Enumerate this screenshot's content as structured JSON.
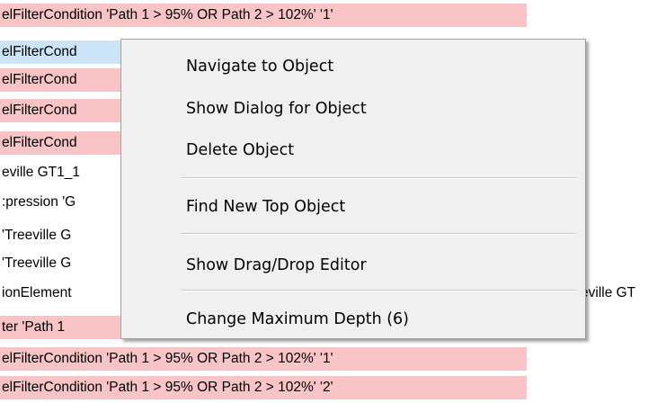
{
  "tree": {
    "rows": [
      "elFilterCondition 'Path 1 > 95% OR Path 2 > 102%' '1'",
      "elFilterCond",
      "elFilterCond",
      "elFilterCond",
      "elFilterCond",
      "eville GT1_1",
      ":pression 'G",
      " 'Treeville G",
      " 'Treeville G",
      "ionElement",
      "ter 'Path 1",
      "elFilterCondition 'Path 1 > 95% OR Path 2 > 102%' '1'",
      "elFilterCondition 'Path 1 > 95% OR Path 2 > 102%' '2'"
    ],
    "row_suffix_right": "eville GT"
  },
  "context_menu": {
    "items": [
      "Navigate to Object",
      "Show Dialog for Object",
      "Delete Object",
      "Find New Top Object",
      "Show Drag/Drop Editor",
      "Change Maximum Depth (6)"
    ]
  }
}
